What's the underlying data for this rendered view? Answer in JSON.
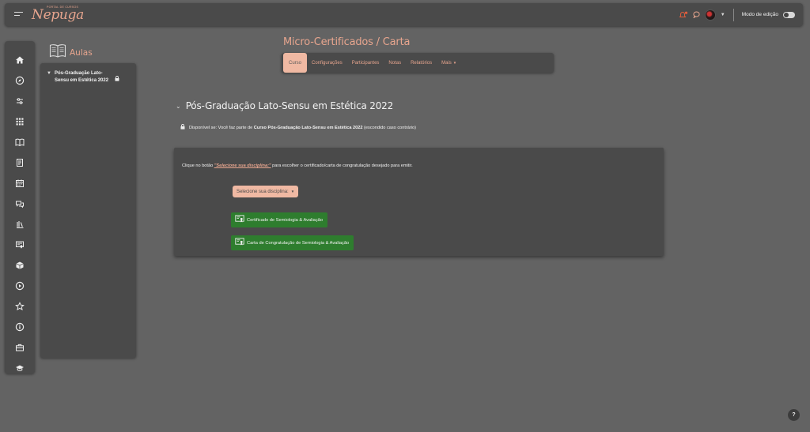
{
  "navbar": {
    "logo_small": "PORTAL DE CURSOS",
    "logo_script": "Nepuga",
    "edit_mode_label": "Modo de edição",
    "colors": {
      "accent": "#e7a58e",
      "notification": "#e25d3c"
    }
  },
  "rail": {
    "icons": [
      "home-icon",
      "compass-icon",
      "sliders-icon",
      "grid-icon",
      "book-icon",
      "document-icon",
      "calendar-icon",
      "chat-icon",
      "library-icon",
      "certificate-icon",
      "cube-icon",
      "play-icon",
      "star-icon",
      "info-icon",
      "briefcase-icon",
      "graduation-icon"
    ]
  },
  "drawer": {
    "title": "Aulas",
    "item_label": "Pós-Graduação Lato-Sensu em Estética 2022"
  },
  "header": {
    "title": "Micro-Certificados / Carta",
    "tabs": [
      {
        "label": "Curso",
        "active": true
      },
      {
        "label": "Configurações",
        "active": false
      },
      {
        "label": "Participantes",
        "active": false
      },
      {
        "label": "Notas",
        "active": false
      },
      {
        "label": "Relatórios",
        "active": false
      },
      {
        "label": "Mais",
        "active": false
      }
    ]
  },
  "section": {
    "title": "Pós-Graduação Lato-Sensu em Estética 2022",
    "restriction_prefix": "Disponível se: Você faz parte de ",
    "restriction_bold": "Curso Pós-Graduação Lato-Sensu em Estética 2022",
    "restriction_suffix": " (escondido caso contrário)"
  },
  "card": {
    "instr_prefix": "Clique no botão ",
    "instr_highlight": "\"Selecione sua disciplina:\"",
    "instr_suffix": " para escolher o certificado/carta de congratulação desejado para emitir.",
    "select_label": "Selecione sua disciplina:",
    "buttons": [
      "Certificado de Semiologia & Avaliação",
      "Carta de Congratulação de Semiologia & Avaliação"
    ]
  },
  "help_label": "?"
}
